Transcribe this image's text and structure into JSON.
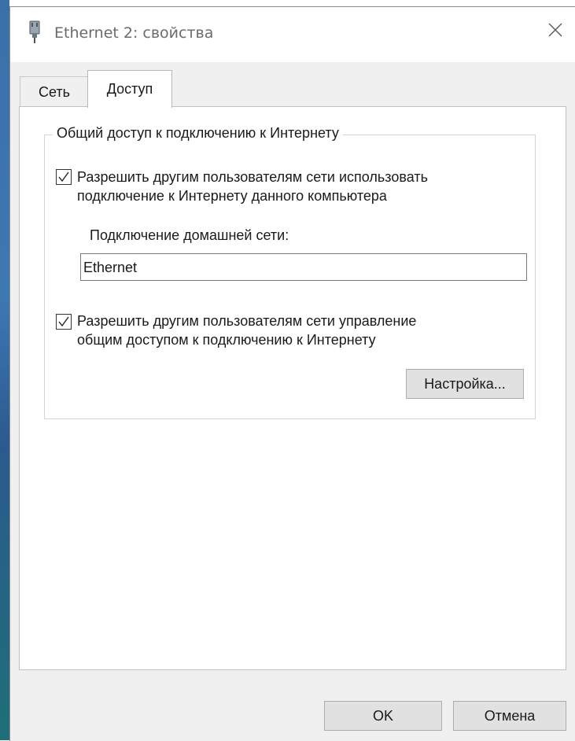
{
  "background": {
    "partial_text": "Ethernet"
  },
  "window": {
    "title": "Ethernet 2: свойства",
    "close_symbol": "×"
  },
  "tabs": [
    {
      "label": "Сеть",
      "active": false
    },
    {
      "label": "Доступ",
      "active": true
    }
  ],
  "sharing": {
    "group_title": "Общий доступ к подключению к Интернету",
    "allow_share": {
      "checked": true,
      "line1": "Разрешить другим пользователям сети использовать",
      "line2": "подключение к Интернету данного компьютера"
    },
    "home_label": "Подключение домашней сети:",
    "home_value": "Ethernet",
    "allow_control": {
      "checked": true,
      "line1": "Разрешить другим пользователям сети управление",
      "line2": "общим доступом к подключению к Интернету"
    },
    "settings_label": "Настройка..."
  },
  "footer": {
    "ok_label": "OK",
    "cancel_label": "Отмена"
  },
  "icons": {
    "title": "network-adapter-icon",
    "close": "close-icon",
    "check": "checkmark-icon"
  },
  "colors": {
    "dialog_bg": "#f0f0f0",
    "panel_bg": "#ffffff",
    "button_bg": "#e1e1e1",
    "title_text": "#6b6b6b"
  }
}
